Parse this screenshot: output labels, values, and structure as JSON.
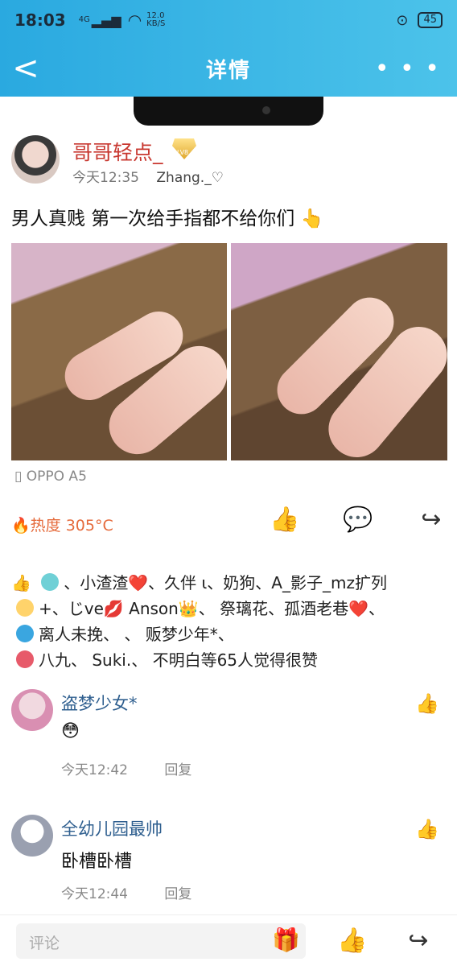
{
  "status": {
    "time": "18:03",
    "signal": "4G",
    "speed_value": "12.0",
    "speed_unit": "KB/S",
    "battery": "45"
  },
  "nav": {
    "back": "<",
    "title": "详情",
    "more": "• • •"
  },
  "post": {
    "author": "哥哥轻点_",
    "time": "今天12:35",
    "by": "Zhang._♡",
    "text": "男人真贱 第一次给手指都不给你们 👆",
    "device": "OPPO A5",
    "heat": "🔥热度 305°C"
  },
  "likes": {
    "line1": "、小渣渣❤️、久伴 ι、奶狗、A_影子_mz扩列",
    "line2": "+、じve💋 Anson👑、 祭璃花、孤酒老巷❤️、",
    "line3": "离人未挽、                    、 贩梦少年*、",
    "line4": "八九、 Suki.、 不明白等65人觉得很赞"
  },
  "comments": [
    {
      "name": "盗梦少女*",
      "text": "😳",
      "time": "今天12:42",
      "reply": "回复"
    },
    {
      "name": "全幼儿园最帅",
      "text": "卧槽卧槽",
      "time": "今天12:44",
      "reply": "回复"
    }
  ],
  "bottom": {
    "placeholder": "评论"
  },
  "colors": {
    "header": "#2aa9e0",
    "author": "#c8372f",
    "heat": "#e56a3b",
    "commenter": "#2f5f8f"
  }
}
